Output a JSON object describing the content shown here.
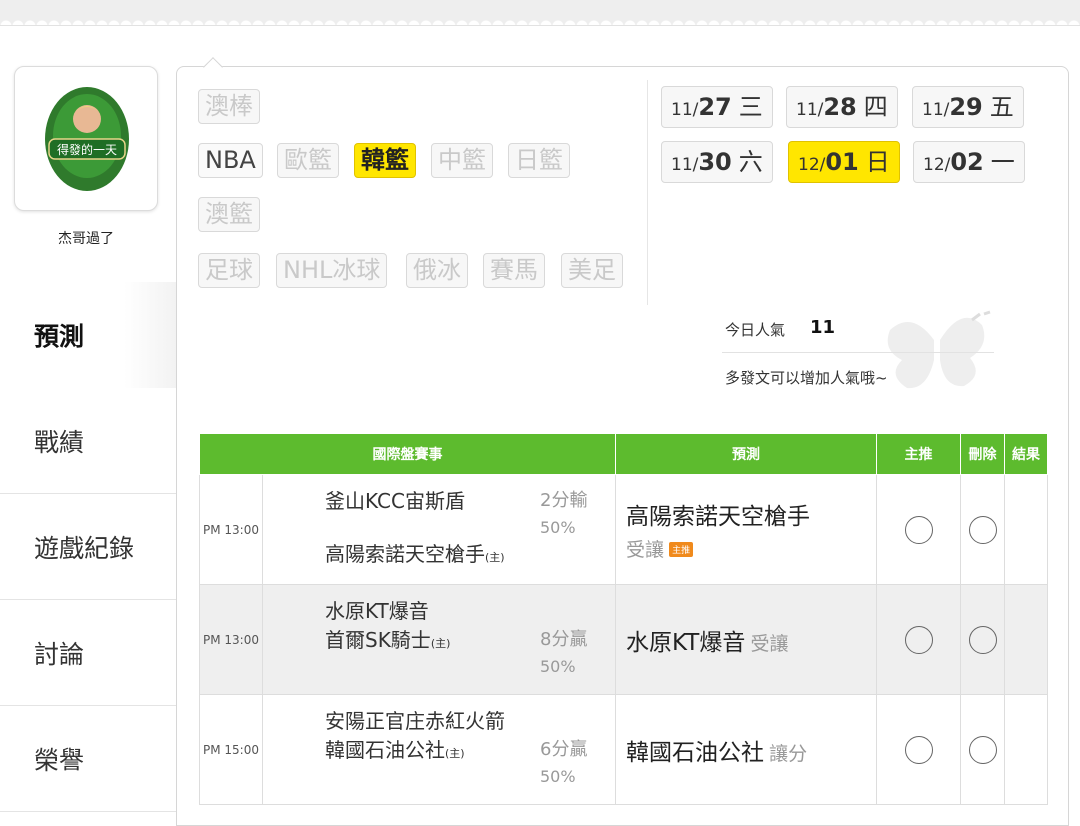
{
  "profile": {
    "username": "杰哥過了",
    "avatar_label": "得發的一天"
  },
  "nav": [
    {
      "label": "預測",
      "active": true
    },
    {
      "label": "戰績"
    },
    {
      "label": "遊戲紀錄"
    },
    {
      "label": "討論"
    },
    {
      "label": "榮譽"
    }
  ],
  "sports": {
    "row1": [
      "澳棒"
    ],
    "row2": [
      "NBA",
      "歐籃",
      "韓籃",
      "中籃",
      "日籃"
    ],
    "row3": [
      "澳籃"
    ],
    "row4": [
      "足球",
      "NHL冰球",
      "俄冰",
      "賽馬",
      "美足"
    ],
    "active": "韓籃"
  },
  "dates": [
    {
      "md": "11/",
      "dd": "27",
      "wk": "三"
    },
    {
      "md": "11/",
      "dd": "28",
      "wk": "四"
    },
    {
      "md": "11/",
      "dd": "29",
      "wk": "五"
    },
    {
      "md": "11/",
      "dd": "30",
      "wk": "六"
    },
    {
      "md": "12/",
      "dd": "01",
      "wk": "日",
      "active": true
    },
    {
      "md": "12/",
      "dd": "02",
      "wk": "一"
    }
  ],
  "popularity": {
    "label": "今日人氣",
    "value": "11",
    "tip": "多發文可以增加人氣哦~"
  },
  "table": {
    "headers": [
      "國際盤賽事",
      "預測",
      "主推",
      "刪除",
      "結果"
    ],
    "home_mark": "(主)",
    "rows": [
      {
        "time": "PM 13:00",
        "away": "釜山KCC宙斯盾",
        "home": "高陽索諾天空槍手",
        "spread": "2分輸",
        "pct": "50%",
        "pred_team": "高陽索諾天空槍手",
        "pred_kind": "受讓",
        "badge": "主推"
      },
      {
        "time": "PM 13:00",
        "away": "水原KT爆音",
        "home": "首爾SK騎士",
        "spread": "8分贏",
        "pct": "50%",
        "pred_team": "水原KT爆音",
        "pred_kind": "受讓"
      },
      {
        "time": "PM 15:00",
        "away": "安陽正官庄赤紅火箭",
        "home": "韓國石油公社",
        "spread": "6分贏",
        "pct": "50%",
        "pred_team": "韓國石油公社",
        "pred_kind": "讓分"
      }
    ]
  },
  "colors": {
    "accent_green": "#5dbb2e",
    "active_yellow": "#ffe600"
  }
}
